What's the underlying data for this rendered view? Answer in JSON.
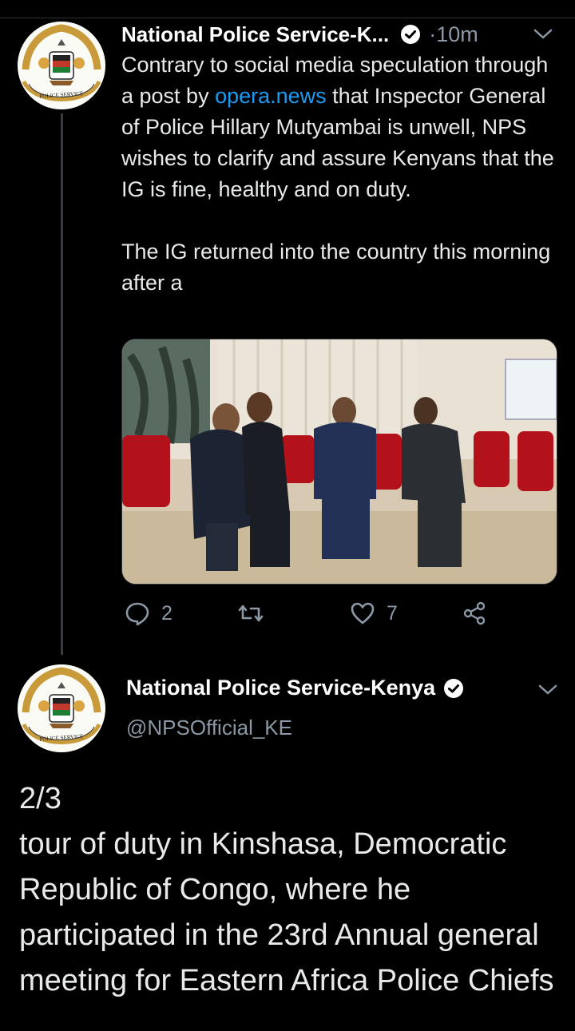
{
  "colors": {
    "background": "#000000",
    "text": "#e7e9ea",
    "secondary": "#8b98a5",
    "link": "#1d9bf0",
    "verified": "#ffffff"
  },
  "tweet1": {
    "author_name": "National Police Service-K...",
    "time_prefix": "·",
    "time": "10m",
    "text_before_link": "Contrary to social media speculation through a post by ",
    "link_text": "opera.news",
    "text_after_link": " that Inspector General of Police Hillary Mutyambai is unwell, NPS wishes to clarify and assure Kenyans that the IG is fine, healthy and on duty.\n\nThe IG returned into the country this morning after a",
    "replies": "2",
    "retweets": "",
    "likes": "7",
    "icons": [
      "reply-icon",
      "retweet-icon",
      "like-icon",
      "share-icon"
    ]
  },
  "tweet2": {
    "author_name": "National Police Service-Kenya",
    "handle": "@NPSOfficial_KE",
    "text": "2/3\ntour of duty in Kinshasa, Democratic Republic of Congo, where he participated in the 23rd Annual general meeting for Eastern Africa Police Chiefs"
  },
  "avatar": {
    "seal_text": "NATIONAL POLICE SERVICE"
  }
}
